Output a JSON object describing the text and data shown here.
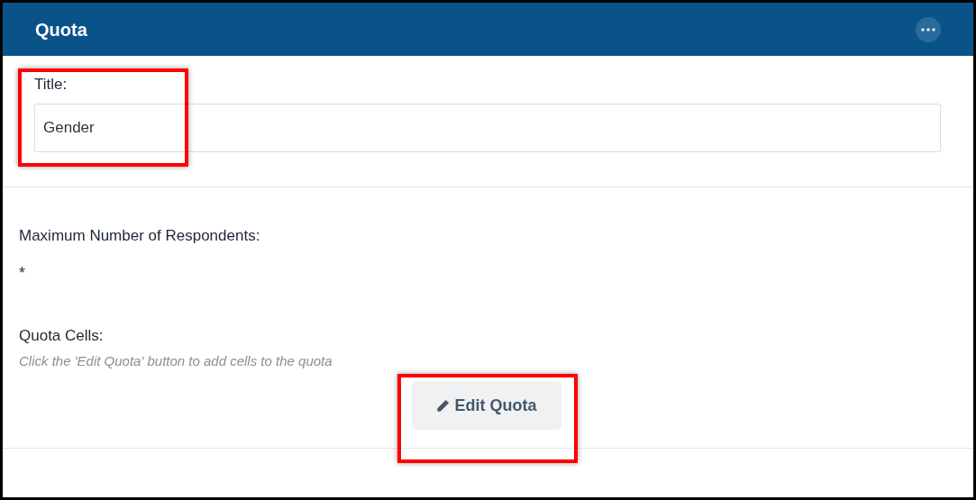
{
  "panel": {
    "title": "Quota"
  },
  "title_field": {
    "label": "Title:",
    "value": "Gender"
  },
  "max_respondents": {
    "label": "Maximum Number of Respondents:",
    "value": "*"
  },
  "quota_cells": {
    "label": "Quota Cells:",
    "hint": "Click the 'Edit Quota' button to add cells to the quota"
  },
  "buttons": [
    {
      "label": "Edit Quota"
    }
  ]
}
